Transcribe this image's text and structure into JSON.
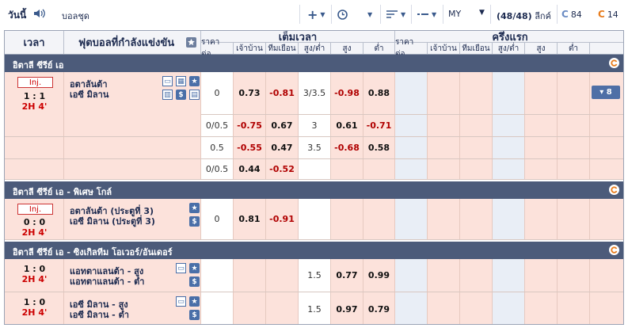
{
  "topbar": {
    "today_label": "วันนี้",
    "sport_label": "บอลชุด",
    "market_label": "MY",
    "count_value": "(48/48)",
    "count_unit": "ลีกค์",
    "coin_84": "84",
    "coin_14": "14"
  },
  "header": {
    "col_time": "เวลา",
    "col_match": "ฟุตบอลที่กำลังแข่งขัน",
    "full_time": "เต็มเวลา",
    "first_half": "ครึ่งแรก",
    "sub": [
      "ราคาต่อ..",
      "เจ้าบ้าน",
      "ทีมเยือน",
      "สูง/ต่ำ",
      "สูง",
      "ต่ำ"
    ]
  },
  "leagues": [
    {
      "name": "อิตาลี ซีรีย์ เอ",
      "match": {
        "status": "Inj.",
        "score": "1 : 1",
        "time": "2H 4'",
        "home": "อตาลันต้า",
        "away": "เอซี มิลาน",
        "more": "▾ 8"
      },
      "lines": [
        {
          "hdp": "0",
          "home": "0.73",
          "away": "-0.81",
          "ou": "3/3.5",
          "over": "-0.98",
          "under": "0.88"
        },
        {
          "hdp": "0/0.5",
          "home": "-0.75",
          "away": "0.67",
          "ou": "3",
          "over": "0.61",
          "under": "-0.71"
        },
        {
          "hdp": "0.5",
          "home": "-0.55",
          "away": "0.47",
          "ou": "3.5",
          "over": "-0.68",
          "under": "0.58"
        },
        {
          "hdp": "0/0.5",
          "home": "0.44",
          "away": "-0.52",
          "ou": "",
          "over": "",
          "under": ""
        }
      ]
    },
    {
      "name": "อิตาลี ซีรีย์ เอ - พิเศษ โกล์",
      "match": {
        "status": "Inj.",
        "score": "0 : 0",
        "time": "2H 4'",
        "home": "อตาลันต้า (ประตูที่ 3)",
        "away": "เอซี มิลาน (ประตูที่ 3)"
      },
      "lines": [
        {
          "hdp": "0",
          "home": "0.81",
          "away": "-0.91"
        }
      ]
    },
    {
      "name": "อิตาลี ซีรีย์ เอ - ซิงเกิลทีม โอเวอร์/อันเดอร์",
      "matches": [
        {
          "score": "1 : 0",
          "time": "2H 4'",
          "home": "แอทตาแลนต้า - สูง",
          "away": "แอทตาแลนต้า - ต่ำ",
          "ou": "1.5",
          "over": "0.77",
          "under": "0.99"
        },
        {
          "score": "1 : 0",
          "time": "2H 4'",
          "home": "เอซี มิลาน - สูง",
          "away": "เอซี มิลาน - ต่ำ",
          "ou": "1.5",
          "over": "0.97",
          "under": "0.79"
        }
      ]
    }
  ]
}
